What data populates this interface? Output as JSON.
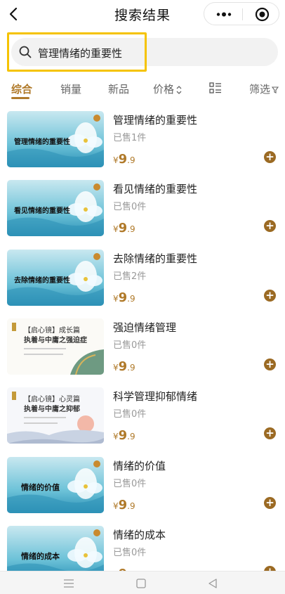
{
  "header": {
    "title": "搜索结果"
  },
  "search": {
    "query": "管理情绪的重要性"
  },
  "tabs": [
    {
      "label": "综合",
      "active": true
    },
    {
      "label": "销量",
      "active": false
    },
    {
      "label": "新品",
      "active": false
    },
    {
      "label": "价格",
      "active": false
    },
    {
      "label": "筛选",
      "active": false
    }
  ],
  "price": {
    "currency": "¥",
    "integer": "9",
    "decimal": ".9"
  },
  "products": [
    {
      "title": "管理情绪的重要性",
      "sold": "已售1件",
      "thumb_text": "管理情绪的重要性",
      "style": "flower"
    },
    {
      "title": "看见情绪的重要性",
      "sold": "已售0件",
      "thumb_text": "看见情绪的重要性",
      "style": "flower"
    },
    {
      "title": "去除情绪的重要性",
      "sold": "已售2件",
      "thumb_text": "去除情绪的重要性",
      "style": "flower"
    },
    {
      "title": "强迫情绪管理",
      "sold": "已售0件",
      "thumb_title": "【启心镜】成长篇",
      "thumb_sub": "执着与中庸之强迫症",
      "style": "doc-green"
    },
    {
      "title": "科学管理抑郁情绪",
      "sold": "已售0件",
      "thumb_title": "【启心镜】心灵篇",
      "thumb_sub": "执着与中庸之抑郁",
      "style": "doc-sun"
    },
    {
      "title": "情绪的价值",
      "sold": "已售0件",
      "thumb_text": "情绪的价值",
      "style": "flower"
    },
    {
      "title": "情绪的成本",
      "sold": "已售0件",
      "thumb_text": "情绪的成本",
      "style": "flower"
    }
  ],
  "icons": {
    "back": "chevron-left-icon",
    "more": "more-dots-icon",
    "target": "target-icon",
    "search": "search-icon",
    "sort": "sort-arrows-icon",
    "grid": "grid-list-icon",
    "filter": "filter-icon",
    "add": "add-circle-icon"
  },
  "colors": {
    "accent": "#b07a2a",
    "highlight": "#f5c300",
    "add_button": "#9b6a23"
  }
}
